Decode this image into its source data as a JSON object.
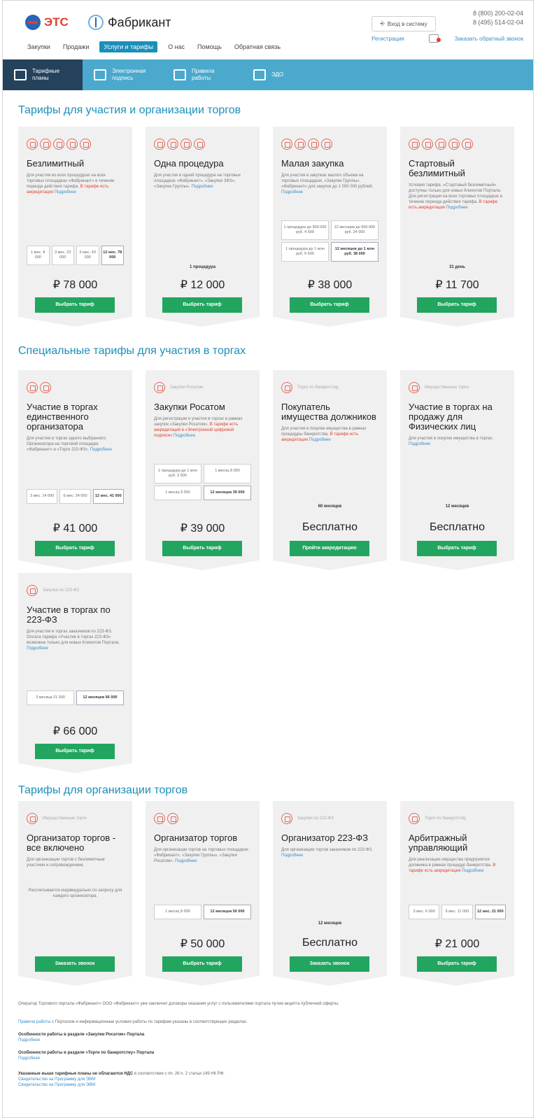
{
  "header": {
    "logo_ets": "ЭТС",
    "logo_fab": "Фабрикант",
    "nav": [
      "Закупки",
      "Продажи",
      "Услуги и тарифы",
      "О нас",
      "Помощь",
      "Обратная связь"
    ],
    "nav_active": "Услуги и тарифы",
    "login": "Вход в систему",
    "register": "Регистрация",
    "phone1": "8 (800) 200-02-04",
    "phone2": "8 (495) 514-02-04",
    "callback": "Заказать обратный звонок"
  },
  "subnav": [
    {
      "label": "Тарифные планы",
      "active": true
    },
    {
      "label": "Электронная подпись",
      "active": false
    },
    {
      "label": "Правила работы",
      "active": false
    },
    {
      "label": "ЭДО",
      "active": false
    }
  ],
  "sections": {
    "s1": "Тарифы для участия и организации торгов",
    "s2": "Специальные тарифы для участия в торгах",
    "s3": "Тарифы для организации торгов"
  },
  "cards": {
    "c1": {
      "title": "Безлимитный",
      "desc": "Для участия во всех процедурах на всех торговых площадках «Фабрикант» в течение периода действия тарифа.",
      "desc_link": "Подробнее",
      "desc_red": "В тарифе есть аккредитация",
      "periods": [
        "1 мес. 8 000",
        "3 мес. 23 000",
        "6 мес. 43 000",
        "12 мес. 78 000"
      ],
      "price": "₽ 78 000",
      "button": "Выбрать тариф"
    },
    "c2": {
      "title": "Одна процедура",
      "desc": "Для участия в одной процедуре на торговых площадках «Фабрикант», «Закупки ЗФЗ», «Закупки Группы».",
      "desc_link": "Подробнее",
      "plabel": "1 процедура",
      "price": "₽ 12 000",
      "button": "Выбрать тариф"
    },
    "c3": {
      "title": "Малая закупка",
      "desc": "Для участия в закупках малого объема на торговых площадках, «Закупки Группы», «Фабрикант» для закупок до 1 000 000 рублей.",
      "desc_link": "Подробнее",
      "periods": [
        "1 процедура до 500 000 руб. 4 500",
        "12 месяцев до 500 000 руб. 24 000",
        "1 процедура до 1 млн руб. 6 500",
        "12 месяцев до 1 млн руб. 38 000"
      ],
      "price": "₽ 38 000",
      "button": "Выбрать тариф"
    },
    "c4": {
      "title": "Стартовый безлимитный",
      "desc": "Условия тарифа: «Стартовый безлимитный» доступны только для новых Клиентов Портала. Для регистрации на всех торговых площадках в течение периода действия тарифа.",
      "desc_link": "Подробнее",
      "desc_red": "В тарифе есть аккредитация",
      "plabel": "31 день",
      "price": "₽ 11 700",
      "button": "Выбрать тариф"
    },
    "c5": {
      "title": "Участие в торгах единственного организатора",
      "desc": "Для участия в торгах одного выбранного Организатора на торговой площадке «Фабрикант» и «Торги 223-ФЗ».",
      "desc_link": "Подробнее",
      "periods": [
        "3 мес. 14 000",
        "6 мес. 24 000",
        "12 мес. 41 000"
      ],
      "price": "₽ 41 000",
      "button": "Выбрать тариф"
    },
    "c6": {
      "title": "Закупки Росатом",
      "icon_caption": "Закупки Росатом",
      "desc": "Для регистрации и участия в торгах в рамках закупок «Закупки Росатом».",
      "desc_red": "В тарифе есть аккредитация в «Электронной цифровой подписи»",
      "desc_link": "Подробнее",
      "periods": [
        "1 процедура до 1 млн руб. 3 500",
        "1 месяц 8 000",
        "1 месяц 9 000",
        "12 месяцев 39 000"
      ],
      "price": "₽ 39 000",
      "button": "Выбрать тариф"
    },
    "c7": {
      "title": "Покупатель имущества должников",
      "icon_caption": "Торги по банкротству",
      "desc": "Для участия в покупке имущества в рамках процедуры банкротства.",
      "desc_red": "В тарифе есть аккредитация",
      "desc_link": "Подробнее",
      "plabel": "60 месяцев",
      "price": "Бесплатно",
      "button": "Пройти аккредитацию"
    },
    "c8": {
      "title": "Участие в торгах на продажу для Физических лиц",
      "icon_caption": "Имущественные торги",
      "desc": "Для участия в покупке имущества в торгах.",
      "desc_link": "Подробнее",
      "plabel": "12 месяцев",
      "price": "Бесплатно",
      "button": "Выбрать тариф"
    },
    "c9": {
      "title": "Участие в торгах по 223-ФЗ",
      "icon_caption": "Закупки по 223-ФЗ",
      "desc": "Для участия в торгах заказчиков по 223-ФЗ. Оплата тарифа «Участие в торгах 223-ФЗ» возможна только для новых Клиентов Портала.",
      "desc_link": "Подробнее",
      "periods": [
        "3 месяца 21 000",
        "12 месяцев 66 000"
      ],
      "price": "₽ 66 000",
      "button": "Выбрать тариф"
    },
    "c10": {
      "title": "Организатор торгов - все включено",
      "icon_caption": "Имущественные торги",
      "desc": "Для организации торгов с безлимитным участием и сопровождением.",
      "note": "Рассчитывается индивидуально по запросу для каждого организатора.",
      "button": "Заказать звонок"
    },
    "c11": {
      "title": "Организатор торгов",
      "desc": "Для организации торгов на торговых площадках «Фабрикант», «Закупки Группы», «Закупки Росатом».",
      "desc_link": "Подробнее",
      "periods": [
        "1 месяц 8 000",
        "12 месяцев 50 000"
      ],
      "price": "₽ 50 000",
      "button": "Выбрать тариф"
    },
    "c12": {
      "title": "Организатор 223-ФЗ",
      "icon_caption": "Закупки по 223-ФЗ",
      "desc": "Для организации торгов заказчиков по 223-ФЗ.",
      "desc_link": "Подробнее",
      "plabel": "12 месяцев",
      "price": "Бесплатно",
      "button": "Заказать звонок"
    },
    "c13": {
      "title": "Арбитражный управляющий",
      "icon_caption": "Торги по банкротству",
      "desc": "Для реализации имущества предприятия должника в рамках процедур банкротства.",
      "desc_red": "В тарифе есть аккредитация",
      "desc_link": "Подробнее",
      "periods": [
        "3 мес. 6 000",
        "6 мес. 11 000",
        "12 мес. 21 000"
      ],
      "price": "₽ 21 000",
      "button": "Выбрать тариф"
    }
  },
  "footer": {
    "p1": "Оператор Торгового портала «Фабрикант» ООО «Фабрикант» уже заключил договоры оказания услуг с пользователями портала путем акцепта публичной оферты.",
    "p2_link": "Правила работы",
    "p2": "с Порталом и информационные условия работы по тарифам указаны в соответствующих разделах.",
    "p3_b": "Особенности работы в разделе «Закупки Росатом» Портала",
    "p3_link": "Подробнее",
    "p4_b": "Особенности работы в разделе «Торги по банкротству» Портала",
    "p4_link": "Подробнее",
    "p5_b": "Указанные выше тарифные планы не облагаются НДС",
    "p5": "в соответствии с пп. 26 п. 2 статьи 149 НК РФ.",
    "p5_link1": "Свидетельство на Программу для ЭВМ",
    "p5_link2": "Свидетельство на Программу для ЭВМ"
  }
}
